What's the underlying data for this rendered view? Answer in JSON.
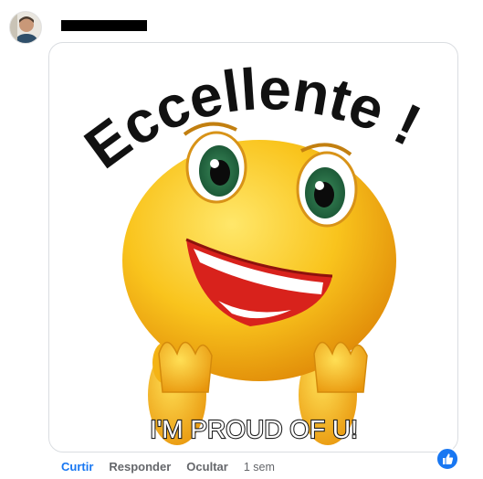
{
  "comment": {
    "author_name_redacted": true,
    "gif": {
      "title_text": "Eccellente !",
      "caption": "I'M PROUD OF U!"
    },
    "actions": {
      "like": "Curtir",
      "reply": "Responder",
      "hide": "Ocultar",
      "timestamp": "1 sem"
    },
    "reaction": {
      "icon": "thumbs-up-icon",
      "color": "#1877f2"
    }
  },
  "colors": {
    "link_blue": "#1877f2",
    "secondary_text": "#65676b",
    "emoji_yellow": "#f7c51e",
    "mouth_red": "#d8221c"
  }
}
